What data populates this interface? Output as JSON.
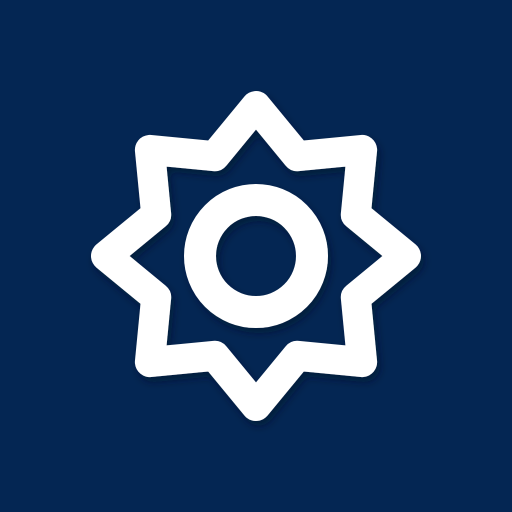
{
  "icon": {
    "semantic": "star-gear-icon",
    "background_color": "#042653",
    "foreground_color": "#ffffff",
    "shadow_color": "#00112a"
  }
}
